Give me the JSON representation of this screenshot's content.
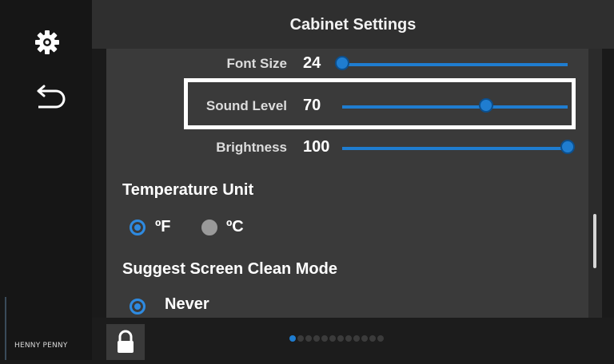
{
  "header": {
    "title": "Cabinet Settings"
  },
  "sidebar": {
    "icons": [
      "gear-icon",
      "back-arrow-icon"
    ],
    "brand": "HENNY PENNY"
  },
  "sliders": [
    {
      "label": "Font Size",
      "value": "24",
      "fraction": 0.0
    },
    {
      "label": "Sound Level",
      "value": "70",
      "fraction": 0.64
    },
    {
      "label": "Brightness",
      "value": "100",
      "fraction": 1.0
    }
  ],
  "temperature": {
    "title": "Temperature Unit",
    "options": [
      {
        "label": "ºF",
        "selected": true
      },
      {
        "label": "ºC",
        "selected": false
      }
    ]
  },
  "clean_mode": {
    "title": "Suggest Screen Clean Mode",
    "options": [
      {
        "label": "Never",
        "selected": true
      }
    ]
  },
  "pager": {
    "total": 12,
    "current": 1
  },
  "colors": {
    "accent": "#1f7dd0",
    "panel": "#3a3a3a",
    "highlight": "#ffffff"
  }
}
